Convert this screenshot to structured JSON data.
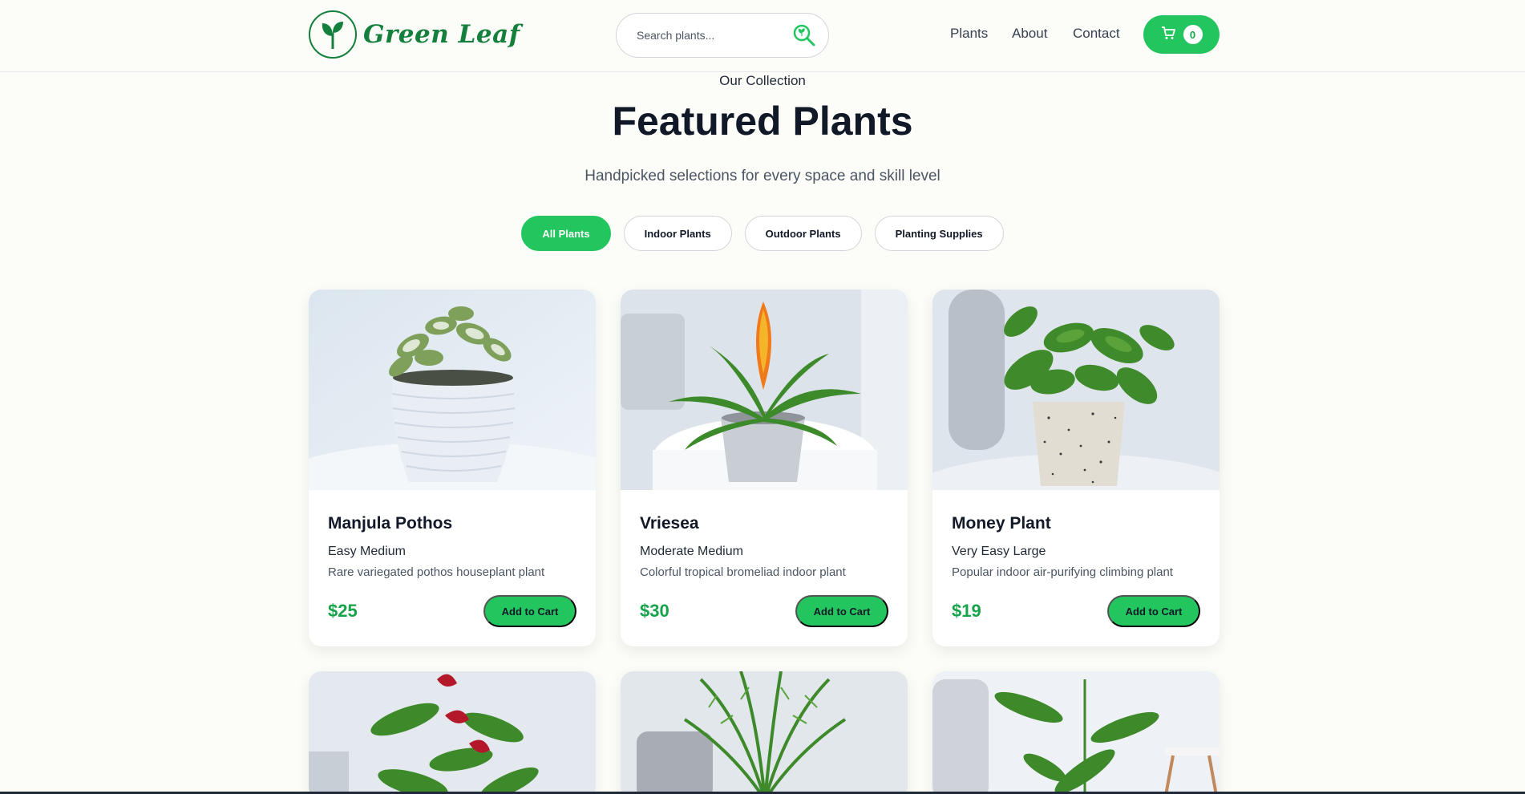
{
  "brand": {
    "name": "Green Leaf"
  },
  "search": {
    "placeholder": "Search plants..."
  },
  "nav": {
    "plants": "Plants",
    "about": "About",
    "contact": "Contact"
  },
  "cart": {
    "count": "0"
  },
  "hero": {
    "eyebrow": "Our Collection",
    "title": "Featured Plants",
    "subtitle": "Handpicked selections for every space and skill level"
  },
  "filters": [
    "All Plants",
    "Indoor Plants",
    "Outdoor Plants",
    "Planting Supplies"
  ],
  "products": [
    {
      "name": "Manjula Pothos",
      "meta": "Easy Medium",
      "description": "Rare variegated pothos houseplant plant",
      "price": "$25",
      "button": "Add to Cart"
    },
    {
      "name": "Vriesea",
      "meta": "Moderate Medium",
      "description": "Colorful tropical bromeliad indoor plant",
      "price": "$30",
      "button": "Add to Cart"
    },
    {
      "name": "Money Plant",
      "meta": "Very Easy Large",
      "description": "Popular indoor air-purifying climbing plant",
      "price": "$19",
      "button": "Add to Cart"
    }
  ],
  "colors": {
    "accent": "#22c55e",
    "brand": "#15803d",
    "price": "#16a34a"
  }
}
